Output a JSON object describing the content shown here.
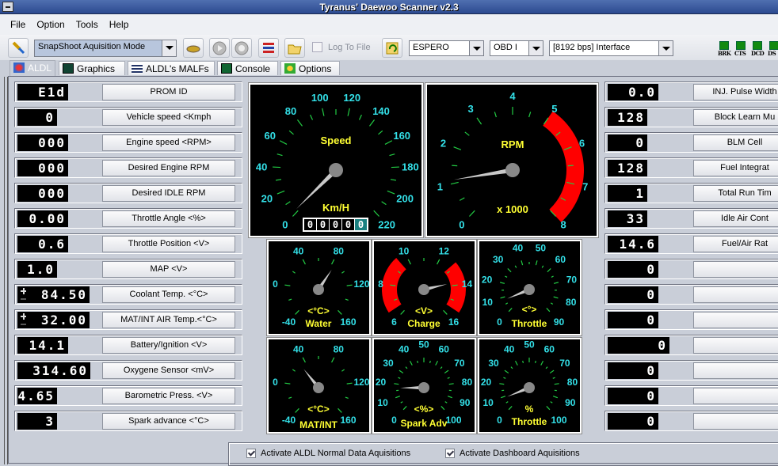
{
  "window": {
    "title": "Tyranus' Daewoo Scanner v2.3"
  },
  "menu": [
    "File",
    "Option",
    "Tools",
    "Help"
  ],
  "toolbar": {
    "mode": "SnapShoot Aquisition Mode",
    "log_to_file": "Log To File",
    "log_to_file_checked": false,
    "car": "ESPERO",
    "protocol": "OBD I",
    "interface": "[8192 bps] Interface",
    "leds": [
      {
        "label": "BRK",
        "color": "#118a11"
      },
      {
        "label": "CTS",
        "color": "#118a11"
      },
      {
        "label": "DCD",
        "color": "#118a11"
      },
      {
        "label": "DS",
        "color": "#118a11"
      }
    ]
  },
  "tabs": [
    {
      "label": "ALDL",
      "active": true
    },
    {
      "label": "Graphics"
    },
    {
      "label": "ALDL's MALFs"
    },
    {
      "label": "Console"
    },
    {
      "label": "Options"
    }
  ],
  "left_params": [
    {
      "label": "PROM ID",
      "value": "E1d",
      "digits": 4
    },
    {
      "label": "Vehicle speed <Kmph",
      "value": "0",
      "digits": 3
    },
    {
      "label": "Engine speed <RPM>",
      "value": "000",
      "digits": 4
    },
    {
      "label": "Desired Engine RPM",
      "value": "000",
      "digits": 4
    },
    {
      "label": "Desired IDLE RPM",
      "value": "000",
      "digits": 4
    },
    {
      "label": "Throttle Angle <%>",
      "value": "0.00",
      "digits": 4
    },
    {
      "label": "Throttle Position <V>",
      "value": "0.6",
      "digits": 4
    },
    {
      "label": "MAP <V>",
      "value": "1.0",
      "digits": 3
    },
    {
      "label": "Coolant Temp. <°C>",
      "value": "84.50",
      "digits": 5,
      "signed": true
    },
    {
      "label": "MAT/INT AIR Temp.<°C>",
      "value": "32.00",
      "digits": 5,
      "signed": true
    },
    {
      "label": "Battery/Ignition <V>",
      "value": "14.1",
      "digits": 4
    },
    {
      "label": "Oxygene Sensor <mV>",
      "value": "314.60",
      "digits": 6
    },
    {
      "label": "Barometric Press. <V>",
      "value": "4.65",
      "digits": 3
    },
    {
      "label": "Spark advance  <°C>",
      "value": "3",
      "digits": 3
    }
  ],
  "right_params": [
    {
      "label": "INJ. Pulse Width",
      "value": "0.0",
      "digits": 4
    },
    {
      "label": "Block Learn Mu",
      "value": "128",
      "digits": 3
    },
    {
      "label": "BLM Cell",
      "value": "0",
      "digits": 3
    },
    {
      "label": "Fuel Integrat",
      "value": "128",
      "digits": 3
    },
    {
      "label": "Total Run Tim",
      "value": "1",
      "digits": 3
    },
    {
      "label": "Idle Air Cont",
      "value": "33",
      "digits": 3
    },
    {
      "label": "Fuel/Air Rat",
      "value": "14.6",
      "digits": 4
    },
    {
      "label": "",
      "value": "0",
      "digits": 4
    },
    {
      "label": "",
      "value": "0",
      "digits": 4
    },
    {
      "label": "",
      "value": "0",
      "digits": 4
    },
    {
      "label": "",
      "value": "0",
      "digits": 5
    },
    {
      "label": "",
      "value": "0",
      "digits": 4
    },
    {
      "label": "",
      "value": "0",
      "digits": 4
    },
    {
      "label": "",
      "value": "0",
      "digits": 4
    }
  ],
  "gauges": [
    {
      "id": "speed",
      "title": "Speed",
      "unit": "Km/H",
      "min": 0,
      "max": 220,
      "label_step": 20,
      "tick_step": 10,
      "value": 2,
      "odometer": [
        "0",
        "0",
        "0",
        "0",
        "0"
      ]
    },
    {
      "id": "rpm",
      "title": "RPM",
      "unit": "x 1000",
      "min": 0,
      "max": 8,
      "label_step": 1,
      "tick_step": 0.5,
      "value": 1.1,
      "red_zones": [
        [
          5,
          8
        ]
      ]
    },
    {
      "id": "water",
      "title": "Water",
      "unit": "<°C>",
      "min": -40,
      "max": 160,
      "label_step": 40,
      "tick_step": 20,
      "value": 84.5
    },
    {
      "id": "charge",
      "title": "Charge",
      "unit": "<V>",
      "min": 6,
      "max": 16,
      "label_step": 2,
      "tick_step": 1,
      "value": 13.8,
      "red_zones": [
        [
          6.5,
          9.5
        ],
        [
          12.8,
          15.5
        ]
      ]
    },
    {
      "id": "throttle-deg",
      "title": "Throttle",
      "unit": "<°>",
      "min": 0,
      "max": 90,
      "label_step": 10,
      "tick_step": 5,
      "value": 8
    },
    {
      "id": "mat",
      "title": "MAT/INT",
      "unit": "<°C>",
      "min": -40,
      "max": 160,
      "label_step": 40,
      "tick_step": 20,
      "value": 32
    },
    {
      "id": "spark",
      "title": "Spark Adv",
      "unit": "<%>",
      "min": 0,
      "max": 100,
      "label_step": 10,
      "tick_step": 5,
      "value": 17
    },
    {
      "id": "throttle-pct",
      "title": "Throttle",
      "unit": "%",
      "min": 0,
      "max": 100,
      "label_step": 10,
      "tick_step": 5,
      "value": 9
    }
  ],
  "bottom": {
    "aldl_normal": "Activate ALDL  Normal Data Aquisitions",
    "aldl_normal_checked": true,
    "dashboard": "Activate Dashboard Aquisitions",
    "dashboard_checked": true
  },
  "colors": {
    "gauge_label": "#33e0e8",
    "gauge_title": "#ffff33",
    "tick": "#22cc44",
    "red_zone": "#ff0000",
    "needle": "#c8c8c8",
    "hub": "#888888"
  }
}
